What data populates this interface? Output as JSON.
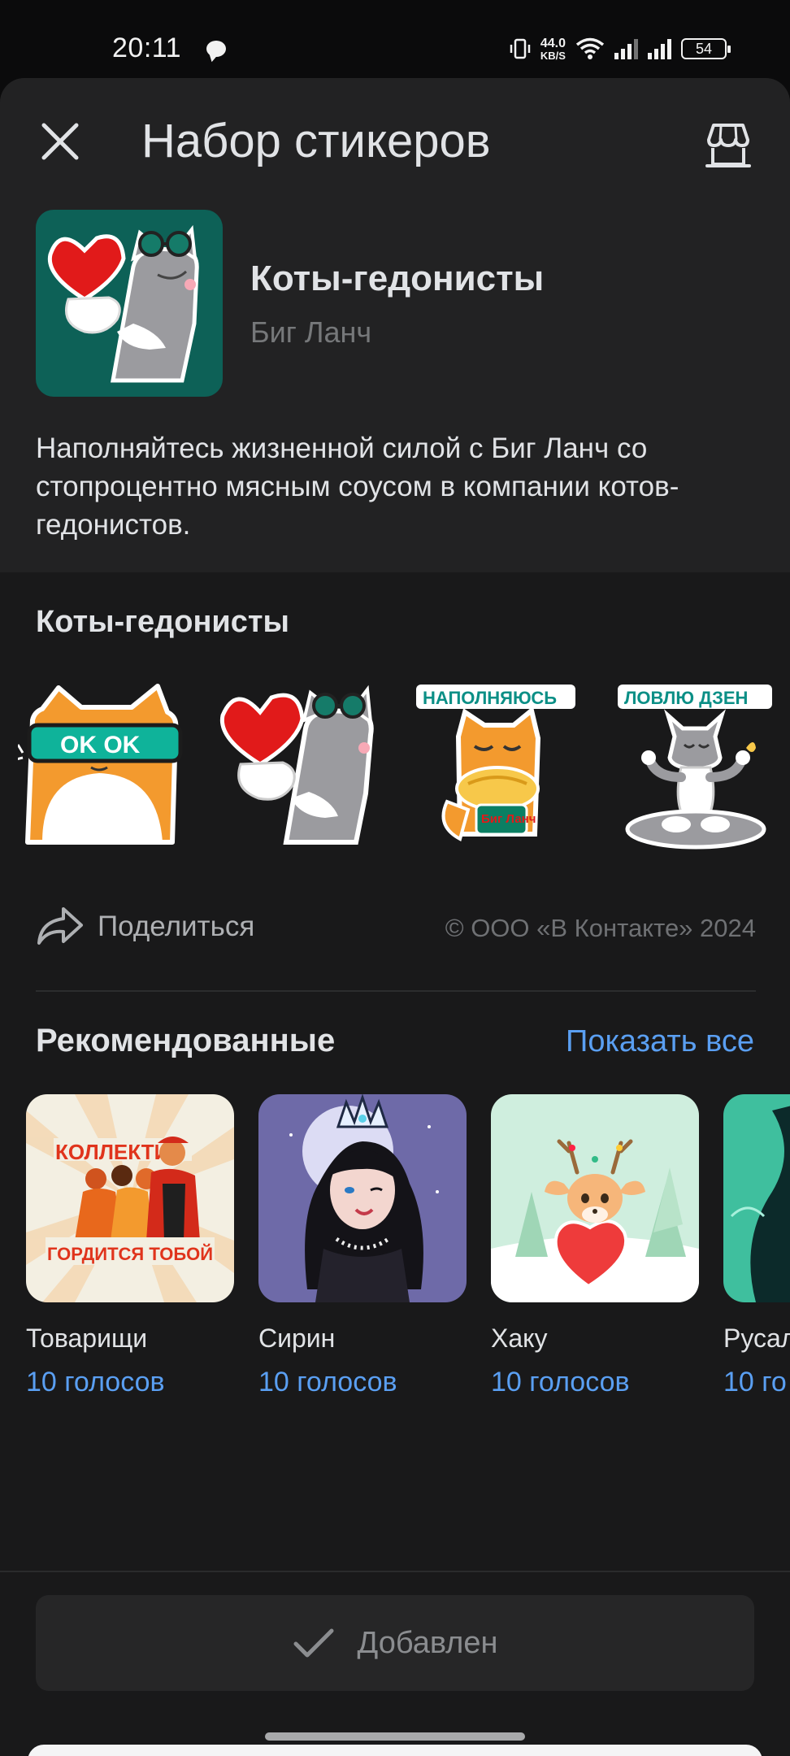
{
  "status_bar": {
    "time": "20:11",
    "speed_value": "44.0",
    "speed_unit": "KB/S",
    "battery": "54"
  },
  "header": {
    "title": "Набор стикеров",
    "close_icon": "close-icon",
    "store_icon": "store-icon"
  },
  "pack": {
    "name": "Коты-гедонисты",
    "author": "Биг Ланч",
    "description": "Наполняйтесь жизненной силой с Биг Ланч со стопроцентно мясным соусом в компании котов-гедонистов.",
    "cover_bg": "#0d6157"
  },
  "stickers_section": {
    "title": "Коты-гедонисты",
    "items": [
      {
        "name": "cat-ok-glasses",
        "text": "OK OK"
      },
      {
        "name": "cat-heart",
        "text": ""
      },
      {
        "name": "cat-naponyayus",
        "text": "НАПОЛНЯЮСЬ"
      },
      {
        "name": "cat-lovlyu-dzen",
        "text": "ЛОВЛЮ ДЗЕН"
      }
    ],
    "sticker_badge": "Биг Ланч"
  },
  "share": {
    "label": "Поделиться",
    "copyright": "© ООО «В Контакте» 2024"
  },
  "recommended": {
    "title": "Рекомендованные",
    "show_all": "Показать все",
    "items": [
      {
        "name": "Товарищи",
        "votes": "10 голосов",
        "art_top": "КОЛЛЕКТИВ",
        "art_bottom": "ГОРДИТСЯ ТОБОЙ"
      },
      {
        "name": "Сирин",
        "votes": "10 голосов"
      },
      {
        "name": "Хаку",
        "votes": "10 голосов"
      },
      {
        "name": "Русал",
        "votes": "10 го"
      }
    ]
  },
  "footer": {
    "added_label": "Добавлен"
  },
  "colors": {
    "accent": "#5a9ff2",
    "sheet_bg": "#19191a",
    "header_bg": "#222223"
  }
}
